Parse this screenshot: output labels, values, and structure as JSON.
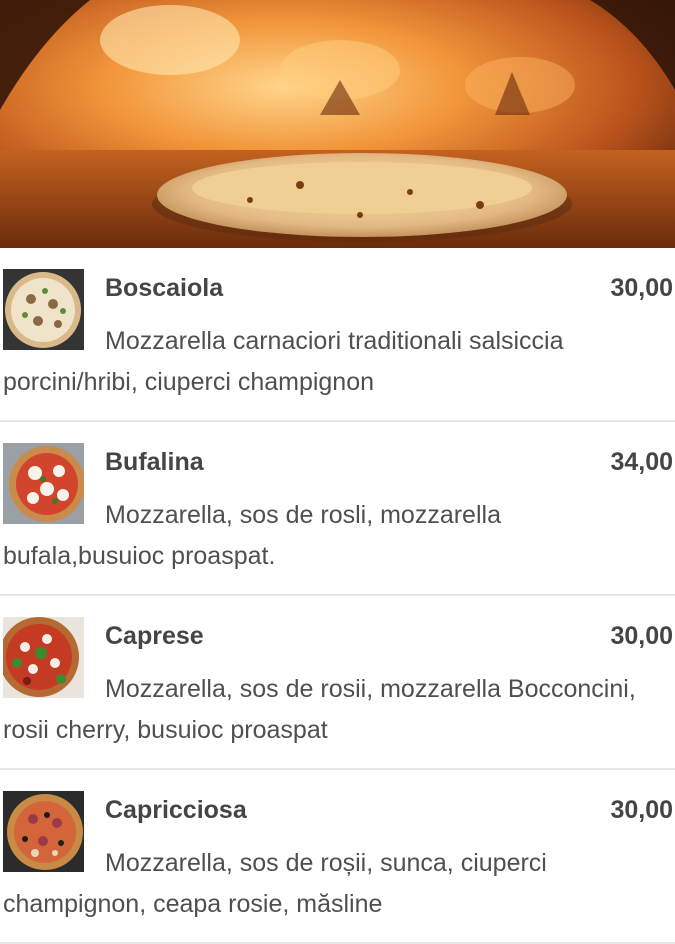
{
  "hero": {
    "image": "pizza-in-wood-fired-oven"
  },
  "menu": {
    "items": [
      {
        "name": "Boscaiola",
        "price": "30,00",
        "description": "Mozzarella carnaciori traditionali salsiccia porcini/hribi, ciuperci champignon",
        "image": "pizza-boscaiola"
      },
      {
        "name": "Bufalina",
        "price": "34,00",
        "description": "Mozzarella, sos de rosli, mozzarella bufala,busuioc proaspat.",
        "image": "pizza-bufalina"
      },
      {
        "name": "Caprese",
        "price": "30,00",
        "description": "Mozzarella, sos de rosii, mozzarella Bocconcini, rosii cherry, busuioc proaspat",
        "image": "pizza-caprese"
      },
      {
        "name": "Capricciosa",
        "price": "30,00",
        "description": "Mozzarella, sos de roșii, sunca, ciuperci champignon, ceapa rosie, măsline",
        "image": "pizza-capricciosa"
      }
    ]
  }
}
